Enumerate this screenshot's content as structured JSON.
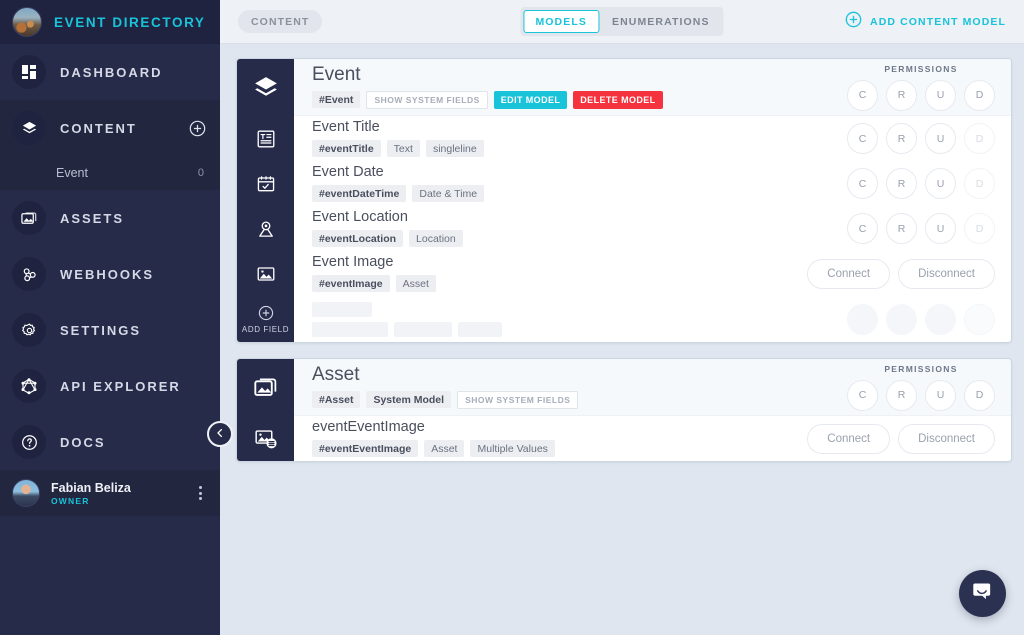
{
  "sidebar": {
    "brand": {
      "title": "EVENT DIRECTORY",
      "avatar_icon": "festival-photo-avatar"
    },
    "items": [
      {
        "label": "DASHBOARD",
        "icon": "dashboard-grid-icon"
      },
      {
        "label": "CONTENT",
        "icon": "layers-icon",
        "action_icon": "plus-circle-icon"
      },
      {
        "label": "ASSETS",
        "icon": "photos-icon"
      },
      {
        "label": "WEBHOOKS",
        "icon": "webhook-icon"
      },
      {
        "label": "SETTINGS",
        "icon": "gear-icon"
      },
      {
        "label": "API EXPLORER",
        "icon": "graphql-icon"
      },
      {
        "label": "DOCS",
        "icon": "question-circle-icon"
      }
    ],
    "content_children": [
      {
        "label": "Event",
        "count": "0"
      }
    ],
    "user": {
      "name": "Fabian Beliza",
      "role": "OWNER",
      "menu_icon": "kebab-menu-icon"
    },
    "collapse_icon": "chevron-left-icon"
  },
  "topbar": {
    "breadcrumb": "CONTENT",
    "tabs": [
      {
        "label": "MODELS",
        "active": true
      },
      {
        "label": "ENUMERATIONS",
        "active": false
      }
    ],
    "add_model": {
      "label": "ADD CONTENT MODEL",
      "icon": "plus-circle-icon"
    }
  },
  "permissions": {
    "title": "PERMISSIONS",
    "letters": [
      "C",
      "R",
      "U",
      "D"
    ],
    "connect": "Connect",
    "disconnect": "Disconnect"
  },
  "rail": {
    "add_field": "ADD FIELD",
    "add_field_icon": "plus-circle-icon"
  },
  "models": [
    {
      "name": "Event",
      "icon": "layers-icon",
      "tags": [
        {
          "text": "#Event",
          "style": "strong"
        },
        {
          "text": "SHOW SYSTEM FIELDS",
          "style": "ghost"
        }
      ],
      "buttons": [
        {
          "label": "EDIT MODEL",
          "color": "teal"
        },
        {
          "label": "DELETE MODEL",
          "color": "red"
        }
      ],
      "perm_state": [
        "on",
        "on",
        "on",
        "on"
      ],
      "fields": [
        {
          "name": "Event Title",
          "icon": "text-document-icon",
          "tags": [
            {
              "text": "#eventTitle",
              "style": "strong"
            },
            {
              "text": "Text",
              "style": "plain"
            },
            {
              "text": "singleline",
              "style": "plain"
            }
          ],
          "right": "perms",
          "perm_state": [
            "on",
            "on",
            "on",
            "off"
          ]
        },
        {
          "name": "Event Date",
          "icon": "calendar-icon",
          "tags": [
            {
              "text": "#eventDateTime",
              "style": "strong"
            },
            {
              "text": "Date & Time",
              "style": "plain"
            }
          ],
          "right": "perms",
          "perm_state": [
            "on",
            "on",
            "on",
            "off"
          ]
        },
        {
          "name": "Event Location",
          "icon": "map-pin-icon",
          "tags": [
            {
              "text": "#eventLocation",
              "style": "strong"
            },
            {
              "text": "Location",
              "style": "plain"
            }
          ],
          "right": "perms",
          "perm_state": [
            "on",
            "on",
            "on",
            "off"
          ]
        },
        {
          "name": "Event Image",
          "icon": "image-icon",
          "tags": [
            {
              "text": "#eventImage",
              "style": "strong"
            },
            {
              "text": "Asset",
              "style": "plain"
            }
          ],
          "right": "connect"
        },
        {
          "name": "",
          "icon": "",
          "tags": [],
          "right": "blank",
          "loading": true
        }
      ]
    },
    {
      "name": "Asset",
      "icon": "photos-icon",
      "tags": [
        {
          "text": "#Asset",
          "style": "strong"
        },
        {
          "text": "System Model",
          "style": "strong"
        },
        {
          "text": "SHOW SYSTEM FIELDS",
          "style": "ghost"
        }
      ],
      "buttons": [],
      "perm_state": [
        "on",
        "on",
        "on",
        "on"
      ],
      "fields": [
        {
          "name": "eventEventImage",
          "icon": "image-multiple-icon",
          "tags": [
            {
              "text": "#eventEventImage",
              "style": "strong"
            },
            {
              "text": "Asset",
              "style": "plain"
            },
            {
              "text": "Multiple Values",
              "style": "plain"
            }
          ],
          "right": "connect"
        }
      ]
    }
  ],
  "chat": {
    "icon": "chat-bubble-icon"
  },
  "colors": {
    "accent": "#19c3d9",
    "danger": "#f5333f",
    "sidebar": "#272b4a",
    "page_bg": "#dfe6ef"
  }
}
